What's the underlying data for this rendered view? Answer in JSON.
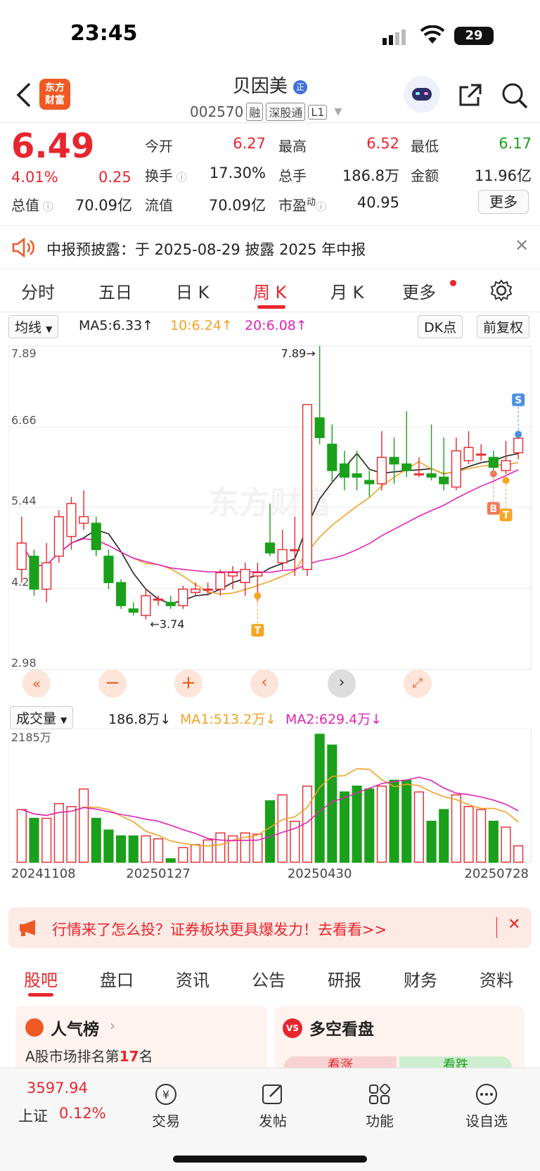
{
  "status": {
    "time": "23:45",
    "battery": "29"
  },
  "nav": {
    "logo_text": "东方\n财富",
    "stock_name": "贝因美",
    "stock_badge": "正",
    "stock_code": "002570",
    "tags": [
      "融",
      "深股通",
      "L1"
    ]
  },
  "quote": {
    "price": "6.49",
    "change_pct": "4.01%",
    "change": "0.25",
    "open_label": "今开",
    "open": "6.27",
    "high_label": "最高",
    "high": "6.52",
    "low_label": "最低",
    "low": "6.17",
    "turnover_label": "换手",
    "turnover": "17.30%",
    "volume_label": "总手",
    "volume": "186.8万",
    "amount_label": "金额",
    "amount": "11.96亿",
    "mktcap_label": "总值",
    "mktcap": "70.09亿",
    "float_label": "流值",
    "float": "70.09亿",
    "pe_label": "市盈",
    "pe_sup": "动",
    "pe": "40.95",
    "more": "更多"
  },
  "notice": {
    "text": "中报预披露：于 2025-08-29 披露 2025 年中报"
  },
  "ktabs": {
    "items": [
      "分时",
      "五日",
      "日 K",
      "周 K",
      "月 K",
      "更多"
    ],
    "active": 3
  },
  "chart_bar": {
    "ma_select": "均线",
    "ma5": "MA5:6.33↑",
    "ma10": "10:6.24↑",
    "ma20": "20:6.08↑",
    "dk": "DK点",
    "fq": "前复权"
  },
  "vol_bar": {
    "select": "成交量",
    "vol": "186.8万↓",
    "ma1": "MA1:513.2万↓",
    "ma2": "MA2:629.4万↓"
  },
  "chart_data": {
    "type": "candlestick",
    "price_axis_labels": [
      "7.89",
      "6.66",
      "5.44",
      "4.21",
      "2.98"
    ],
    "ylim": [
      2.98,
      7.89
    ],
    "max_label": "7.89→",
    "min_label": "←3.74",
    "watermark": "东方财富",
    "volume_axis_label": "2185万",
    "x_dates": [
      "20241108",
      "20250127",
      "20250430",
      "20250728"
    ],
    "candles": [
      {
        "o": 4.5,
        "c": 4.9,
        "h": 5.3,
        "l": 4.3
      },
      {
        "o": 4.7,
        "c": 4.2,
        "h": 4.8,
        "l": 4.1
      },
      {
        "o": 4.2,
        "c": 4.6,
        "h": 4.9,
        "l": 4.0
      },
      {
        "o": 4.7,
        "c": 5.3,
        "h": 5.4,
        "l": 4.6
      },
      {
        "o": 5.0,
        "c": 5.5,
        "h": 5.6,
        "l": 4.8
      },
      {
        "o": 5.2,
        "c": 5.3,
        "h": 5.7,
        "l": 5.1
      },
      {
        "o": 5.2,
        "c": 4.8,
        "h": 5.3,
        "l": 4.7
      },
      {
        "o": 4.7,
        "c": 4.3,
        "h": 4.8,
        "l": 4.2
      },
      {
        "o": 4.3,
        "c": 3.95,
        "h": 4.35,
        "l": 3.9
      },
      {
        "o": 3.9,
        "c": 3.85,
        "h": 4.0,
        "l": 3.8
      },
      {
        "o": 3.8,
        "c": 4.1,
        "h": 4.2,
        "l": 3.74
      },
      {
        "o": 4.05,
        "c": 4.05,
        "h": 4.1,
        "l": 3.95
      },
      {
        "o": 4.0,
        "c": 3.95,
        "h": 4.1,
        "l": 3.9
      },
      {
        "o": 3.95,
        "c": 4.2,
        "h": 4.25,
        "l": 3.9
      },
      {
        "o": 4.15,
        "c": 4.2,
        "h": 4.3,
        "l": 4.1
      },
      {
        "o": 4.2,
        "c": 4.2,
        "h": 4.3,
        "l": 4.1
      },
      {
        "o": 4.2,
        "c": 4.45,
        "h": 4.5,
        "l": 4.1
      },
      {
        "o": 4.4,
        "c": 4.45,
        "h": 4.55,
        "l": 4.2
      },
      {
        "o": 4.3,
        "c": 4.5,
        "h": 4.6,
        "l": 4.1
      },
      {
        "o": 4.4,
        "c": 4.45,
        "h": 4.6,
        "l": 4.0
      },
      {
        "o": 4.9,
        "c": 4.75,
        "h": 5.5,
        "l": 4.7
      },
      {
        "o": 4.6,
        "c": 4.8,
        "h": 5.1,
        "l": 4.5
      },
      {
        "o": 4.8,
        "c": 4.8,
        "h": 5.3,
        "l": 4.4
      },
      {
        "o": 4.5,
        "c": 7.0,
        "h": 7.0,
        "l": 4.4
      },
      {
        "o": 6.8,
        "c": 6.5,
        "h": 7.89,
        "l": 6.4
      },
      {
        "o": 6.4,
        "c": 6.0,
        "h": 6.7,
        "l": 5.8
      },
      {
        "o": 6.1,
        "c": 5.9,
        "h": 6.3,
        "l": 5.7
      },
      {
        "o": 5.95,
        "c": 5.9,
        "h": 6.3,
        "l": 5.7
      },
      {
        "o": 5.85,
        "c": 5.8,
        "h": 6.0,
        "l": 5.6
      },
      {
        "o": 5.8,
        "c": 6.2,
        "h": 6.6,
        "l": 5.7
      },
      {
        "o": 6.2,
        "c": 6.1,
        "h": 6.5,
        "l": 5.8
      },
      {
        "o": 6.1,
        "c": 6.0,
        "h": 6.9,
        "l": 5.9
      },
      {
        "o": 5.95,
        "c": 5.95,
        "h": 6.2,
        "l": 5.9
      },
      {
        "o": 5.95,
        "c": 5.9,
        "h": 6.7,
        "l": 5.85
      },
      {
        "o": 5.9,
        "c": 5.8,
        "h": 6.5,
        "l": 5.7
      },
      {
        "o": 5.75,
        "c": 6.3,
        "h": 6.5,
        "l": 5.7
      },
      {
        "o": 6.15,
        "c": 6.35,
        "h": 6.6,
        "l": 6.1
      },
      {
        "o": 6.25,
        "c": 6.25,
        "h": 6.4,
        "l": 6.15
      },
      {
        "o": 6.2,
        "c": 6.05,
        "h": 6.3,
        "l": 5.9
      },
      {
        "o": 6.0,
        "c": 6.15,
        "h": 6.45,
        "l": 5.95
      },
      {
        "o": 6.27,
        "c": 6.49,
        "h": 6.52,
        "l": 6.17
      }
    ],
    "volumes": [
      900,
      750,
      750,
      1000,
      950,
      1250,
      750,
      550,
      450,
      450,
      450,
      400,
      60,
      250,
      300,
      380,
      500,
      450,
      500,
      480,
      1050,
      1150,
      700,
      1300,
      2185,
      2000,
      1200,
      1300,
      1250,
      1300,
      1400,
      1400,
      1200,
      700,
      900,
      1150,
      950,
      900,
      700,
      600,
      280
    ],
    "labels": {
      "buy": "B",
      "take": "T",
      "sell": "S"
    }
  },
  "ad": {
    "text": "行情来了怎么投？证券板块更具爆发力！去看看>>"
  },
  "section_tabs": {
    "items": [
      "股吧",
      "盘口",
      "资讯",
      "公告",
      "研报",
      "财务",
      "资料"
    ],
    "active": 0
  },
  "cards": {
    "left_title": "人气榜",
    "left_sub_prefix": "A股市场排名第",
    "left_rank": "17",
    "left_sub_suffix": "名",
    "right_title": "多空看盘",
    "right_bull": "看涨",
    "right_bear": "看跌"
  },
  "bottom": {
    "index_value": "3597.94",
    "index_name": "上证",
    "index_pct": "0.12%",
    "items": [
      "交易",
      "发帖",
      "功能",
      "设自选"
    ]
  }
}
